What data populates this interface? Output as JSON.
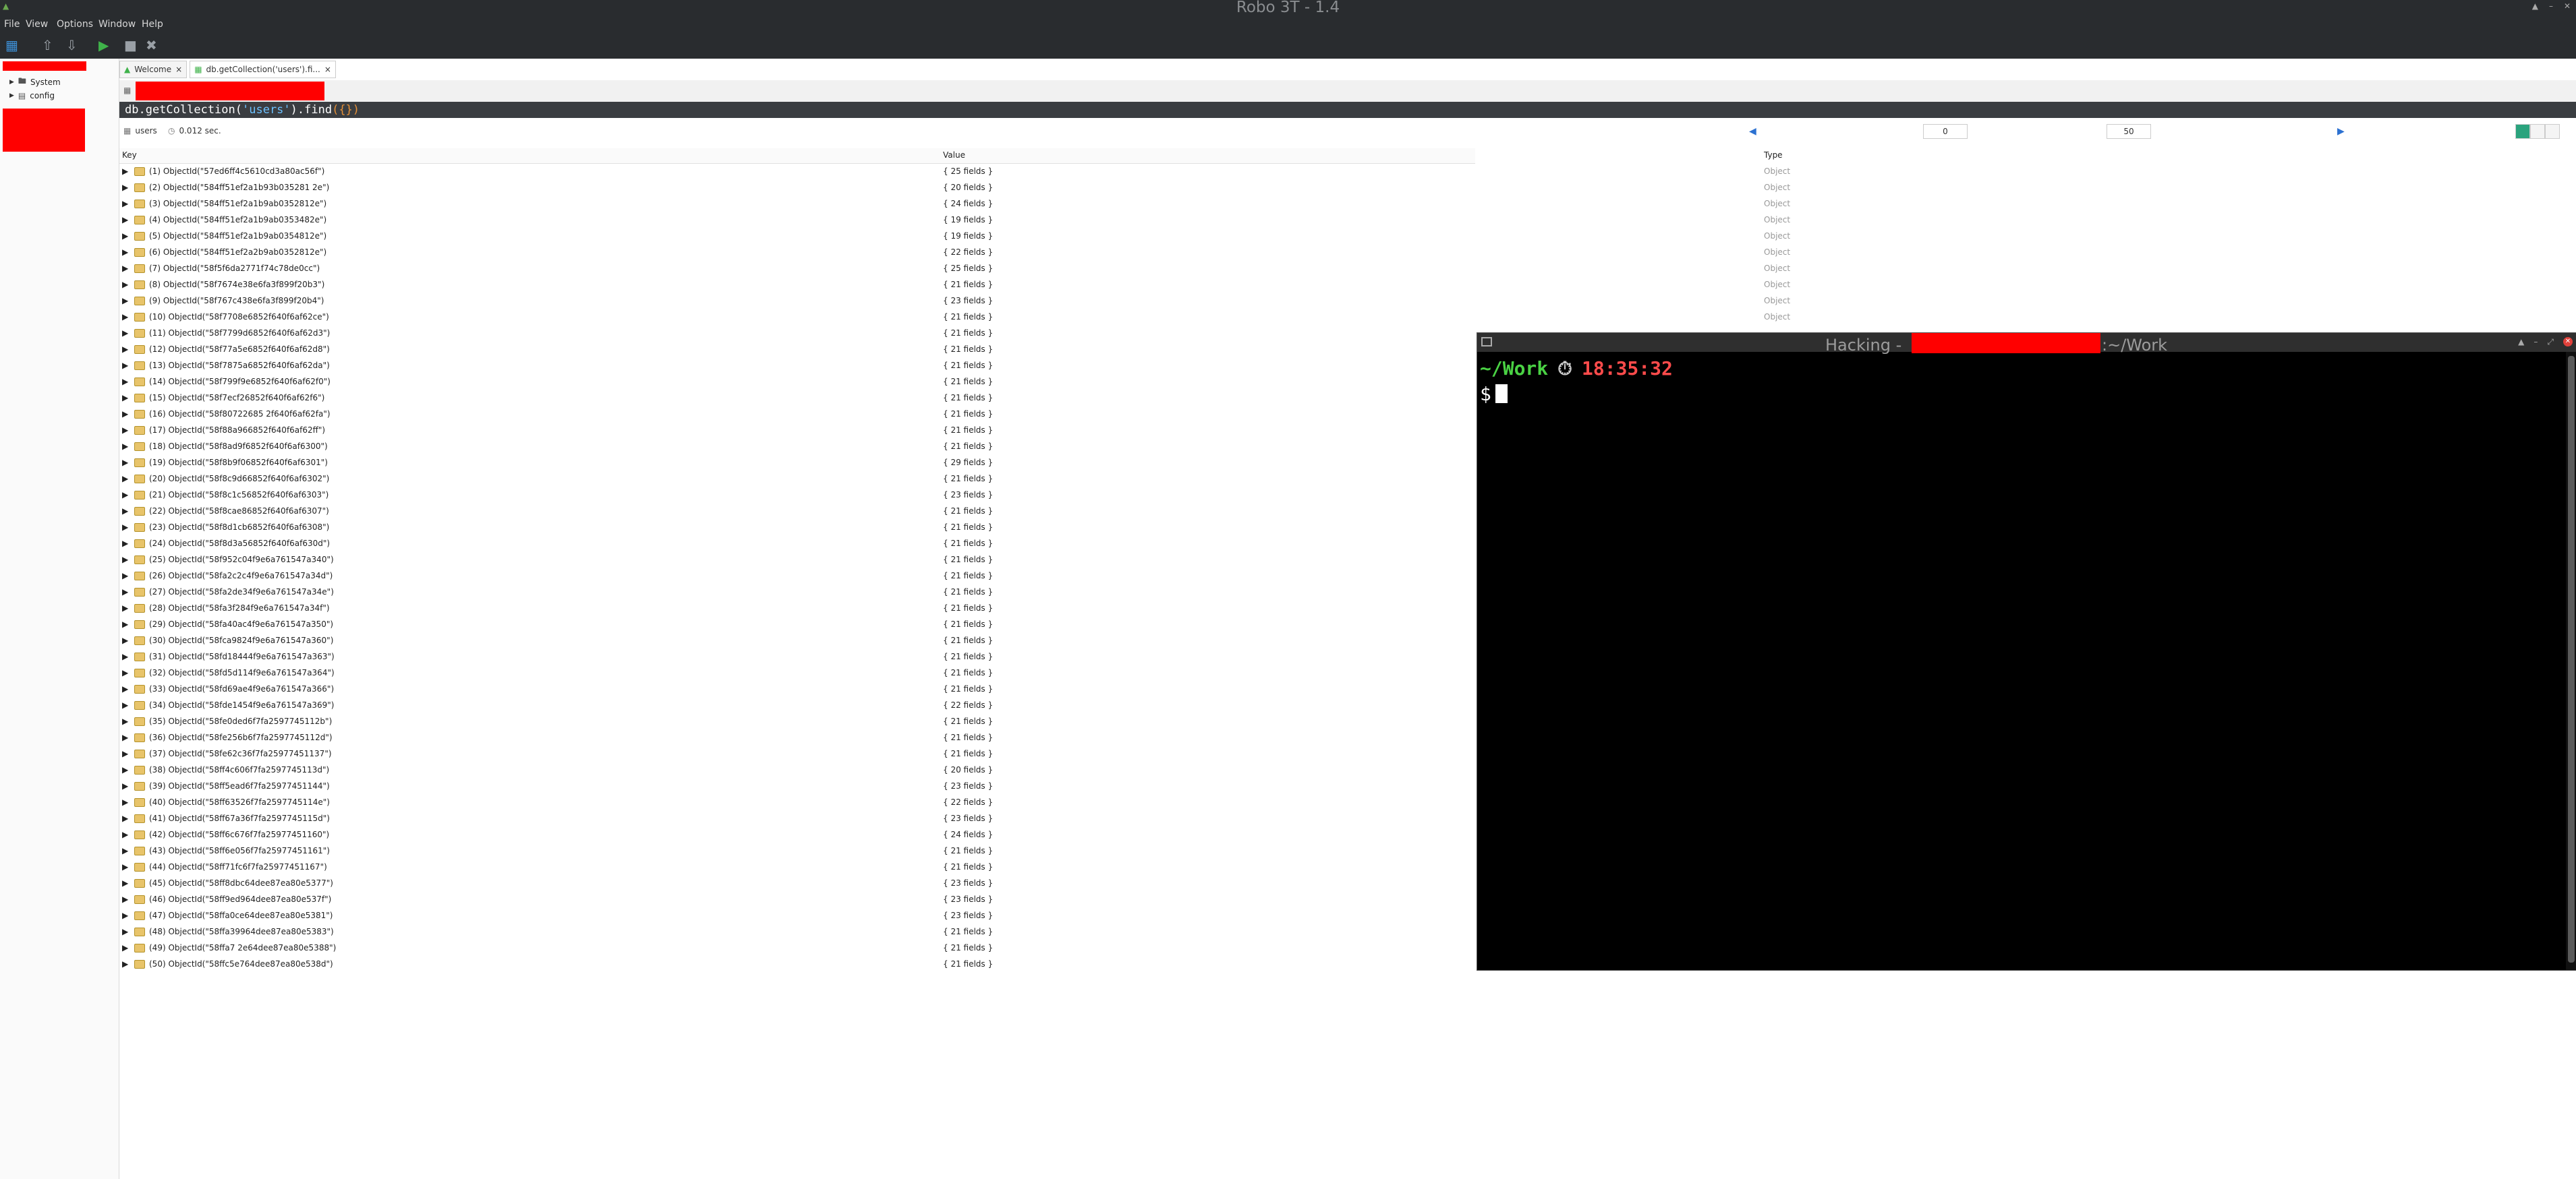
{
  "app": {
    "title": "Robo 3T - 1.4"
  },
  "menu": [
    "File",
    "View",
    "Options",
    "Window",
    "Help"
  ],
  "explorer": {
    "items": [
      {
        "label": "System"
      },
      {
        "label": "config"
      }
    ]
  },
  "tabs": [
    {
      "label": "Welcome"
    },
    {
      "label": "db.getCollection('users').fi..."
    }
  ],
  "query": {
    "prefix": "db.getCollection(",
    "collection": "'users'",
    "middle": ").find",
    "args": "({})"
  },
  "results": {
    "collection": "users",
    "time": "0.012 sec.",
    "page_start": "0",
    "page_size": "50"
  },
  "table": {
    "headers": {
      "key": "Key",
      "value": "Value",
      "type": "Type"
    },
    "type_label": "Object",
    "rows": [
      {
        "key": "(1) ObjectId(\"57ed6ff4c5610cd3a80ac56f\")",
        "value": "{ 25 fields }"
      },
      {
        "key": "(2) ObjectId(\"584ff51ef2a1b93b035281 2e\")",
        "value": "{ 20 fields }"
      },
      {
        "key": "(3) ObjectId(\"584ff51ef2a1b9ab0352812e\")",
        "value": "{ 24 fields }"
      },
      {
        "key": "(4) ObjectId(\"584ff51ef2a1b9ab0353482e\")",
        "value": "{ 19 fields }"
      },
      {
        "key": "(5) ObjectId(\"584ff51ef2a1b9ab0354812e\")",
        "value": "{ 19 fields }"
      },
      {
        "key": "(6) ObjectId(\"584ff51ef2a2b9ab0352812e\")",
        "value": "{ 22 fields }"
      },
      {
        "key": "(7) ObjectId(\"58f5f6da2771f74c78de0cc\")",
        "value": "{ 25 fields }"
      },
      {
        "key": "(8) ObjectId(\"58f7674e38e6fa3f899f20b3\")",
        "value": "{ 21 fields }"
      },
      {
        "key": "(9) ObjectId(\"58f767c438e6fa3f899f20b4\")",
        "value": "{ 23 fields }"
      },
      {
        "key": "(10) ObjectId(\"58f7708e6852f640f6af62ce\")",
        "value": "{ 21 fields }"
      },
      {
        "key": "(11) ObjectId(\"58f7799d6852f640f6af62d3\")",
        "value": "{ 21 fields }"
      },
      {
        "key": "(12) ObjectId(\"58f77a5e6852f640f6af62d8\")",
        "value": "{ 21 fields }"
      },
      {
        "key": "(13) ObjectId(\"58f7875a6852f640f6af62da\")",
        "value": "{ 21 fields }"
      },
      {
        "key": "(14) ObjectId(\"58f799f9e6852f640f6af62f0\")",
        "value": "{ 21 fields }"
      },
      {
        "key": "(15) ObjectId(\"58f7ecf26852f640f6af62f6\")",
        "value": "{ 21 fields }"
      },
      {
        "key": "(16) ObjectId(\"58f80722685 2f640f6af62fa\")",
        "value": "{ 21 fields }"
      },
      {
        "key": "(17) ObjectId(\"58f88a966852f640f6af62ff\")",
        "value": "{ 21 fields }"
      },
      {
        "key": "(18) ObjectId(\"58f8ad9f6852f640f6af6300\")",
        "value": "{ 21 fields }"
      },
      {
        "key": "(19) ObjectId(\"58f8b9f06852f640f6af6301\")",
        "value": "{ 29 fields }"
      },
      {
        "key": "(20) ObjectId(\"58f8c9d66852f640f6af6302\")",
        "value": "{ 21 fields }"
      },
      {
        "key": "(21) ObjectId(\"58f8c1c56852f640f6af6303\")",
        "value": "{ 23 fields }"
      },
      {
        "key": "(22) ObjectId(\"58f8cae86852f640f6af6307\")",
        "value": "{ 21 fields }"
      },
      {
        "key": "(23) ObjectId(\"58f8d1cb6852f640f6af6308\")",
        "value": "{ 21 fields }"
      },
      {
        "key": "(24) ObjectId(\"58f8d3a56852f640f6af630d\")",
        "value": "{ 21 fields }"
      },
      {
        "key": "(25) ObjectId(\"58f952c04f9e6a761547a340\")",
        "value": "{ 21 fields }"
      },
      {
        "key": "(26) ObjectId(\"58fa2c2c4f9e6a761547a34d\")",
        "value": "{ 21 fields }"
      },
      {
        "key": "(27) ObjectId(\"58fa2de34f9e6a761547a34e\")",
        "value": "{ 21 fields }"
      },
      {
        "key": "(28) ObjectId(\"58fa3f284f9e6a761547a34f\")",
        "value": "{ 21 fields }"
      },
      {
        "key": "(29) ObjectId(\"58fa40ac4f9e6a761547a350\")",
        "value": "{ 21 fields }"
      },
      {
        "key": "(30) ObjectId(\"58fca9824f9e6a761547a360\")",
        "value": "{ 21 fields }"
      },
      {
        "key": "(31) ObjectId(\"58fd18444f9e6a761547a363\")",
        "value": "{ 21 fields }"
      },
      {
        "key": "(32) ObjectId(\"58fd5d114f9e6a761547a364\")",
        "value": "{ 21 fields }"
      },
      {
        "key": "(33) ObjectId(\"58fd69ae4f9e6a761547a366\")",
        "value": "{ 21 fields }"
      },
      {
        "key": "(34) ObjectId(\"58fde1454f9e6a761547a369\")",
        "value": "{ 22 fields }"
      },
      {
        "key": "(35) ObjectId(\"58fe0ded6f7fa2597745112b\")",
        "value": "{ 21 fields }"
      },
      {
        "key": "(36) ObjectId(\"58fe256b6f7fa2597745112d\")",
        "value": "{ 21 fields }"
      },
      {
        "key": "(37) ObjectId(\"58fe62c36f7fa25977451137\")",
        "value": "{ 21 fields }"
      },
      {
        "key": "(38) ObjectId(\"58ff4c606f7fa2597745113d\")",
        "value": "{ 20 fields }"
      },
      {
        "key": "(39) ObjectId(\"58ff5ead6f7fa25977451144\")",
        "value": "{ 23 fields }"
      },
      {
        "key": "(40) ObjectId(\"58ff63526f7fa2597745114e\")",
        "value": "{ 22 fields }"
      },
      {
        "key": "(41) ObjectId(\"58ff67a36f7fa2597745115d\")",
        "value": "{ 23 fields }"
      },
      {
        "key": "(42) ObjectId(\"58ff6c676f7fa25977451160\")",
        "value": "{ 24 fields }"
      },
      {
        "key": "(43) ObjectId(\"58ff6e056f7fa25977451161\")",
        "value": "{ 21 fields }"
      },
      {
        "key": "(44) ObjectId(\"58ff71fc6f7fa25977451167\")",
        "value": "{ 21 fields }"
      },
      {
        "key": "(45) ObjectId(\"58ff8dbc64dee87ea80e5377\")",
        "value": "{ 23 fields }"
      },
      {
        "key": "(46) ObjectId(\"58ff9ed964dee87ea80e537f\")",
        "value": "{ 23 fields }"
      },
      {
        "key": "(47) ObjectId(\"58ffa0ce64dee87ea80e5381\")",
        "value": "{ 23 fields }"
      },
      {
        "key": "(48) ObjectId(\"58ffa39964dee87ea80e5383\")",
        "value": "{ 21 fields }"
      },
      {
        "key": "(49) ObjectId(\"58ffa7 2e64dee87ea80e5388\")",
        "value": "{ 21 fields }"
      },
      {
        "key": "(50) ObjectId(\"58ffc5e764dee87ea80e538d\")",
        "value": "{ 21 fields }"
      }
    ]
  },
  "terminal": {
    "title_prefix": "Hacking -",
    "title_suffix": ":~/Work",
    "cwd": "~/Work",
    "time": "18:35:32",
    "prompt": "$"
  },
  "colors": {
    "titlebar": "#292c2f",
    "redaction": "#ff0000",
    "terminal_bg": "#000000",
    "prompt_green": "#4ad244",
    "time_red": "#ff4b4b",
    "query_string_blue": "#6cc1ff"
  }
}
